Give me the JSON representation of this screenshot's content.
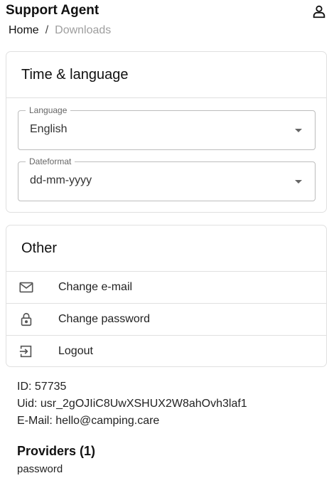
{
  "header": {
    "title": "Support Agent",
    "user_icon": "person-icon"
  },
  "breadcrumb": {
    "home": "Home",
    "separator": "/",
    "current": "Downloads"
  },
  "time_language": {
    "title": "Time & language",
    "language": {
      "label": "Language",
      "value": "English"
    },
    "dateformat": {
      "label": "Dateformat",
      "value": "dd-mm-yyyy"
    }
  },
  "other": {
    "title": "Other",
    "items": [
      {
        "label": "Change e-mail",
        "icon": "mail-icon"
      },
      {
        "label": "Change password",
        "icon": "lock-icon"
      },
      {
        "label": "Logout",
        "icon": "logout-icon"
      }
    ]
  },
  "account": {
    "id_line": "ID: 57735",
    "uid_line": "Uid: usr_2gOJIiC8UwXSHUX2W8ahOvh3laf1",
    "email_line": "E-Mail: hello@camping.care"
  },
  "providers": {
    "title": "Providers (1)",
    "items": [
      "password"
    ]
  },
  "colors": {
    "border": "#e0e0e0",
    "muted": "#9e9e9e",
    "text": "#1a1a1a"
  }
}
